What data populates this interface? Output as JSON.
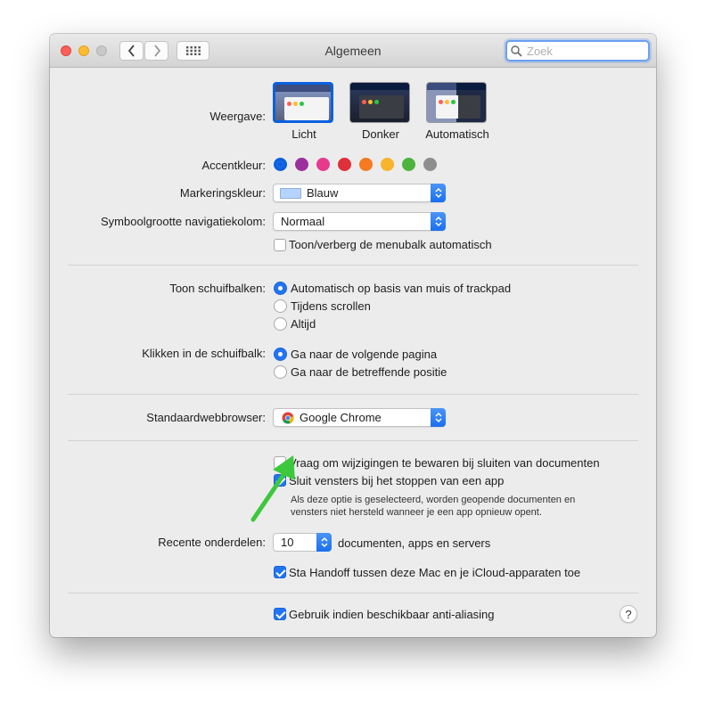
{
  "window": {
    "title": "Algemeen",
    "search_placeholder": "Zoek"
  },
  "appearance": {
    "label": "Weergave:",
    "options": [
      {
        "label": "Licht",
        "selected": true
      },
      {
        "label": "Donker",
        "selected": false
      },
      {
        "label": "Automatisch",
        "selected": false
      }
    ]
  },
  "accent": {
    "label": "Accentkleur:",
    "colors": [
      "#0a60e0",
      "#9b2f9e",
      "#e63a8d",
      "#e0303a",
      "#f57a22",
      "#f7b42c",
      "#4cb33f",
      "#8e8e8e"
    ],
    "selected_index": 0
  },
  "highlight": {
    "label": "Markeringskleur:",
    "value": "Blauw",
    "swatch": "#b5d3ff"
  },
  "sidebar_icon": {
    "label": "Symboolgrootte navigatiekolom:",
    "value": "Normaal"
  },
  "menubar": {
    "label": "Toon/verberg de menubalk automatisch",
    "checked": false
  },
  "scrollbars": {
    "label": "Toon schuifbalken:",
    "options": [
      {
        "label": "Automatisch op basis van muis of trackpad",
        "selected": true
      },
      {
        "label": "Tijdens scrollen",
        "selected": false
      },
      {
        "label": "Altijd",
        "selected": false
      }
    ]
  },
  "click_scroll": {
    "label": "Klikken in de schuifbalk:",
    "options": [
      {
        "label": "Ga naar de volgende pagina",
        "selected": true
      },
      {
        "label": "Ga naar de betreffende positie",
        "selected": false
      }
    ]
  },
  "browser": {
    "label": "Standaardwebbrowser:",
    "value": "Google Chrome"
  },
  "documents": {
    "ask_save": {
      "label": "Vraag om wijzigingen te bewaren bij sluiten van documenten",
      "checked": false
    },
    "close_windows": {
      "label": "Sluit vensters bij het stoppen van een app",
      "checked": true
    },
    "note_line1": "Als deze optie is geselecteerd, worden geopende documenten en",
    "note_line2": "vensters niet hersteld wanneer je een app opnieuw opent."
  },
  "recent": {
    "label": "Recente onderdelen:",
    "value": "10",
    "suffix": "documenten, apps en servers"
  },
  "handoff": {
    "label": "Sta Handoff tussen deze Mac en je iCloud-apparaten toe",
    "checked": true
  },
  "antialias": {
    "label": "Gebruik indien beschikbaar anti-aliasing",
    "checked": true
  },
  "help": {
    "label": "?"
  },
  "annotation": {
    "arrow_color": "#3cc83c"
  }
}
